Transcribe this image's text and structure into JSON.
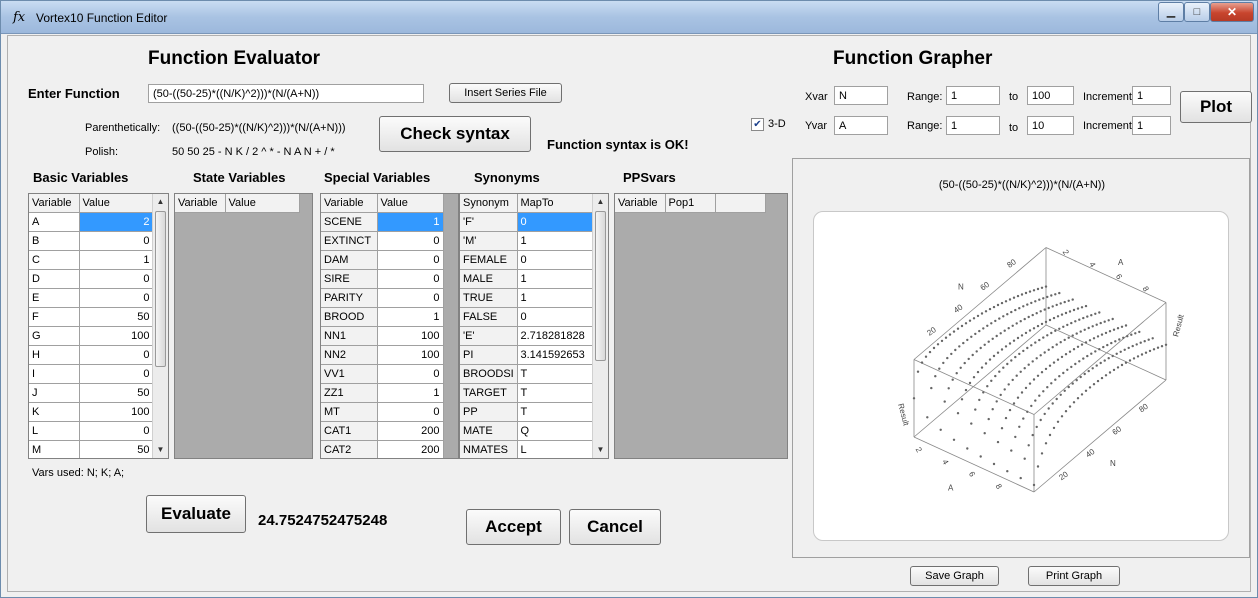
{
  "window": {
    "icon": "fx",
    "title": "Vortex10 Function Editor",
    "minimize_glyph": "▁",
    "maximize_glyph": "□",
    "close_glyph": "✕"
  },
  "evaluator": {
    "heading": "Function Evaluator",
    "enter_label": "Enter Function",
    "function_value": "(50-((50-25)*((N/K)^2)))*(N/(A+N))",
    "insert_series_label": "Insert Series File",
    "paren_label": "Parenthetically:",
    "paren_value": "((50-((50-25)*((N/K)^2)))*(N/(A+N)))",
    "polish_label": "Polish:",
    "polish_value": "50 50 25 - N K / 2 ^ * - N A N + / *",
    "check_syntax_label": "Check syntax",
    "syntax_status": "Function syntax is OK!",
    "three_d_label": "3-D",
    "three_d_checked": true,
    "vars_used": "Vars used: N; K; A;",
    "evaluate_label": "Evaluate",
    "result": "24.7524752475248",
    "accept_label": "Accept",
    "cancel_label": "Cancel"
  },
  "basic_vars": {
    "heading": "Basic Variables",
    "columns": [
      "Variable",
      "Value"
    ],
    "rows": [
      [
        "A",
        "2"
      ],
      [
        "B",
        "0"
      ],
      [
        "C",
        "1"
      ],
      [
        "D",
        "0"
      ],
      [
        "E",
        "0"
      ],
      [
        "F",
        "50"
      ],
      [
        "G",
        "100"
      ],
      [
        "H",
        "0"
      ],
      [
        "I",
        "0"
      ],
      [
        "J",
        "50"
      ],
      [
        "K",
        "100"
      ],
      [
        "L",
        "0"
      ],
      [
        "M",
        "50"
      ]
    ]
  },
  "state_vars": {
    "heading": "State Variables",
    "columns": [
      "Variable",
      "Value"
    ]
  },
  "special_vars": {
    "heading": "Special Variables",
    "columns": [
      "Variable",
      "Value"
    ],
    "rows": [
      [
        "SCENE",
        "1"
      ],
      [
        "EXTINCT",
        "0"
      ],
      [
        "DAM",
        "0"
      ],
      [
        "SIRE",
        "0"
      ],
      [
        "PARITY",
        "0"
      ],
      [
        "BROOD",
        "1"
      ],
      [
        "NN1",
        "100"
      ],
      [
        "NN2",
        "100"
      ],
      [
        "VV1",
        "0"
      ],
      [
        "ZZ1",
        "1"
      ],
      [
        "MT",
        "0"
      ],
      [
        "CAT1",
        "200"
      ],
      [
        "CAT2",
        "200"
      ]
    ]
  },
  "synonyms": {
    "heading": "Synonyms",
    "columns": [
      "Synonym",
      "MapTo"
    ],
    "rows": [
      [
        "'F'",
        "0"
      ],
      [
        "'M'",
        "1"
      ],
      [
        "FEMALE",
        "0"
      ],
      [
        "MALE",
        "1"
      ],
      [
        "TRUE",
        "1"
      ],
      [
        "FALSE",
        "0"
      ],
      [
        "'E'",
        "2.718281828"
      ],
      [
        "PI",
        "3.141592653"
      ],
      [
        "BROODSI",
        "T"
      ],
      [
        "TARGET",
        "T"
      ],
      [
        "PP",
        "T"
      ],
      [
        "MATE",
        "Q"
      ],
      [
        "NMATES",
        "L"
      ]
    ]
  },
  "ppsvars": {
    "heading": "PPSvars",
    "columns": [
      "Variable",
      "Pop1",
      ""
    ]
  },
  "grapher": {
    "heading": "Function Grapher",
    "xvar_label": "Xvar",
    "xvar": "N",
    "yvar_label": "Yvar",
    "yvar": "A",
    "range_label": "Range:",
    "to_label": "to",
    "increment_label": "Increment",
    "x_from": "1",
    "x_to": "100",
    "x_inc": "1",
    "y_from": "1",
    "y_to": "10",
    "y_inc": "1",
    "plot_label": "Plot",
    "graph_title": "(50-((50-25)*((N/K)^2)))*(N/(A+N))",
    "save_label": "Save Graph",
    "print_label": "Print Graph"
  },
  "chart_data": {
    "type": "scatter",
    "title": "(50-((50-25)*((N/K)^2)))*(N/(A+N))",
    "x_axis_label": "N",
    "y_axis_label": "A",
    "z_axis_label": "Result",
    "x_ticks": [
      "20",
      "40",
      "60",
      "80"
    ],
    "y_ticks": [
      "2",
      "4",
      "6",
      "8"
    ],
    "xlim": [
      1,
      100
    ],
    "ylim": [
      1,
      10
    ],
    "ylim_result": [
      0,
      50
    ],
    "x_step": 1,
    "y_step": 1,
    "z_formula": "(50-((50-25)*((N/K)^2)))*(N/(A+N))",
    "K": 100
  }
}
